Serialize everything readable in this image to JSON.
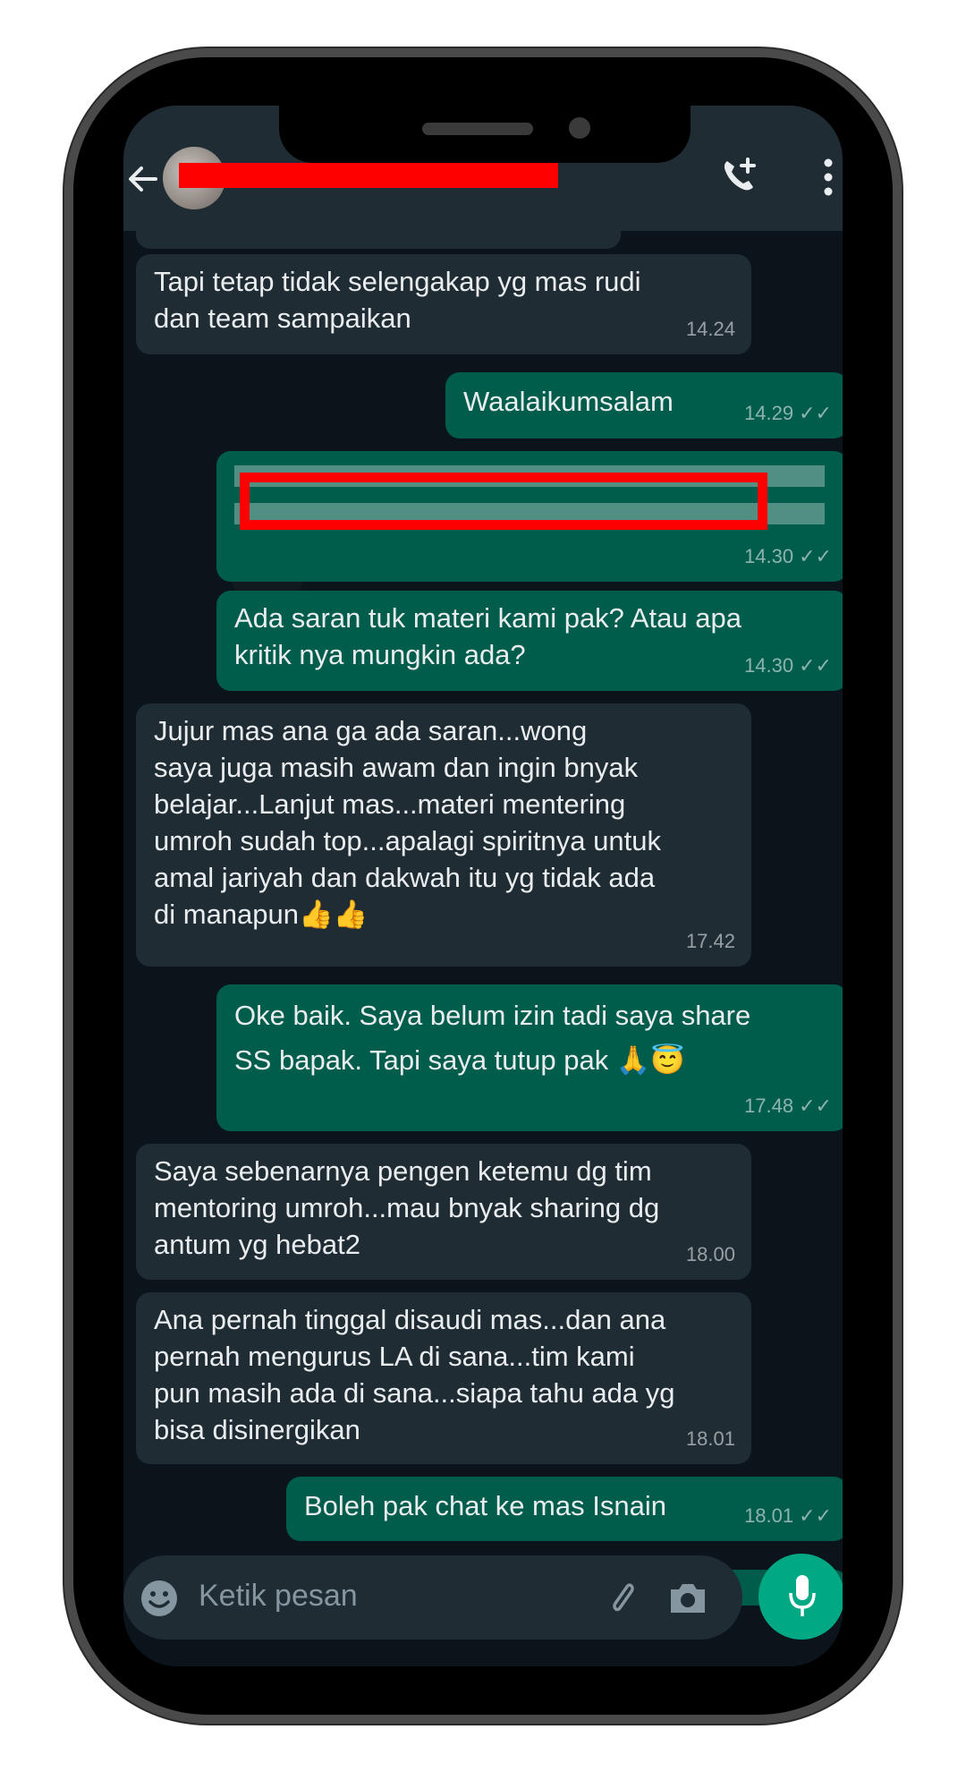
{
  "header": {
    "contact_name": "",
    "back_icon": "arrow-left-icon",
    "call_icon": "add-call-icon",
    "menu_icon": "more-vertical-icon"
  },
  "messages": [
    {
      "direction": "in",
      "text": "Tapi tetap tidak selengakap yg mas rudi\ndan team sampaikan",
      "time": "14.24"
    },
    {
      "direction": "out",
      "text": "Waalaikumsalam",
      "time": "14.29",
      "ticks": "✓✓"
    },
    {
      "direction": "out",
      "text": "",
      "time": "14.30",
      "ticks": "✓✓",
      "redacted": true
    },
    {
      "direction": "out",
      "text": "Ada saran tuk materi kami pak? Atau apa\nkritik nya mungkin ada?",
      "time": "14.30",
      "ticks": "✓✓"
    },
    {
      "direction": "in",
      "text": "Jujur mas ana ga ada saran...wong\nsaya juga masih awam dan ingin bnyak\nbelajar...Lanjut mas...materi mentering\numroh sudah top...apalagi spiritnya untuk\namal jariyah dan dakwah itu yg tidak ada\ndi manapun👍👍",
      "time": "17.42"
    },
    {
      "direction": "out",
      "text": "Oke baik. Saya belum izin tadi saya share\nSS bapak. Tapi saya tutup pak 🙏😇",
      "time": "17.48",
      "ticks": "✓✓"
    },
    {
      "direction": "in",
      "text": "Saya sebenarnya pengen ketemu dg tim\nmentoring umroh...mau bnyak sharing dg\nantum yg hebat2",
      "time": "18.00"
    },
    {
      "direction": "in",
      "text": "Ana pernah tinggal disaudi mas...dan ana\npernah mengurus LA di sana...tim kami\npun masih ada di sana...siapa tahu ada yg\nbisa disinergikan",
      "time": "18.01"
    },
    {
      "direction": "out",
      "text": "Boleh pak chat ke mas Isnain",
      "time": "18.01",
      "ticks": "✓✓"
    }
  ],
  "input": {
    "placeholder": "Ketik pesan",
    "emoji_icon": "emoji-icon",
    "attach_icon": "paperclip-icon",
    "camera_icon": "camera-icon",
    "mic_icon": "microphone-icon"
  },
  "colors": {
    "incoming_bubble": "#202c33",
    "outgoing_bubble": "#005c4b",
    "header": "#1f2c34",
    "accent": "#00a884",
    "redaction": "#ff0000"
  }
}
